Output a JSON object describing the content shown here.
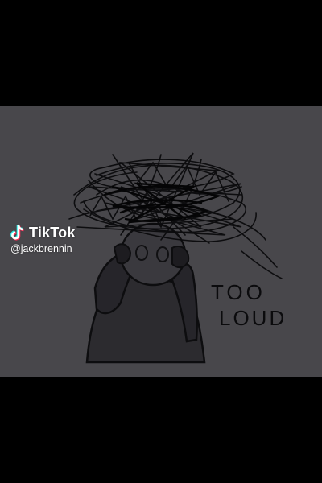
{
  "watermark": {
    "brand": "TikTok",
    "handle": "@jackbrennin",
    "logo_icon": "tiktok-note-icon"
  },
  "artwork": {
    "caption_line1": "TOO",
    "caption_line2": "LOUD"
  },
  "colors": {
    "letterbox": "#000000",
    "panel": "#48474b",
    "ink": "#0b0b0d",
    "tiktok_cyan": "#25f4ee",
    "tiktok_red": "#fe2c55"
  }
}
